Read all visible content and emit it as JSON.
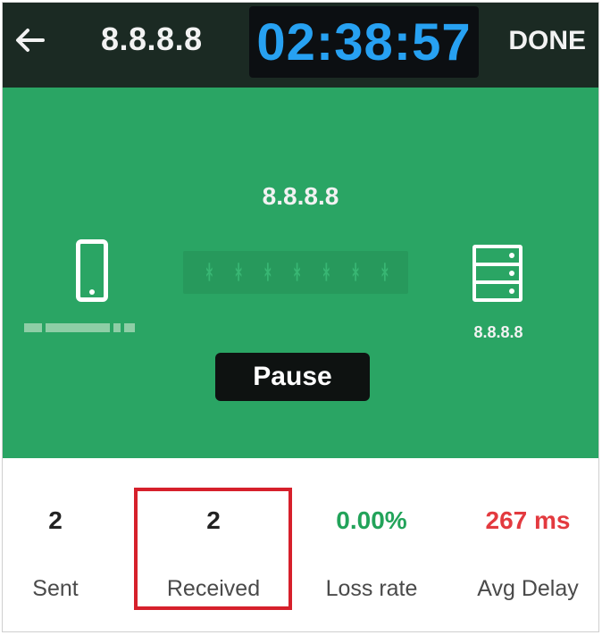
{
  "header": {
    "title": "8.8.8.8",
    "timer": "02:38:57",
    "done_label": "DONE",
    "back_icon": "arrow-left-icon"
  },
  "panel": {
    "target_label": "8.8.8.8",
    "server_label": "8.8.8.8",
    "pause_label": "Pause",
    "device_icon": "phone-icon",
    "server_icon": "server-icon"
  },
  "stats": {
    "sent": {
      "value": "2",
      "label": "Sent"
    },
    "received": {
      "value": "2",
      "label": "Received"
    },
    "loss": {
      "value": "0.00%",
      "label": "Loss rate",
      "color": "#22a35a"
    },
    "delay": {
      "value": "267 ms",
      "label": "Avg Delay",
      "color": "#e33a3f"
    }
  },
  "colors": {
    "header_bg": "#1b2a23",
    "panel_bg": "#2aa564",
    "timer_text": "#27a1f2",
    "highlight_border": "#d6202b"
  }
}
